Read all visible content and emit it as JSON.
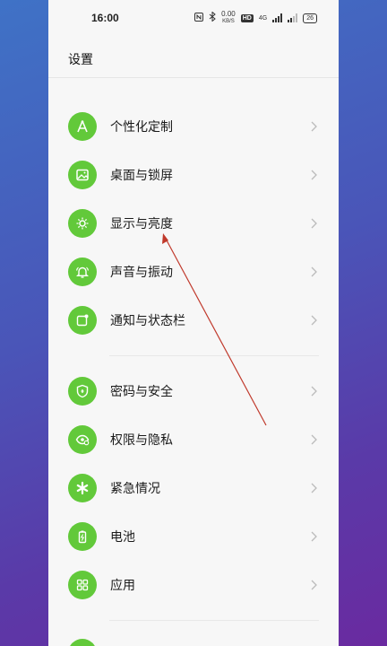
{
  "status": {
    "time": "16:00",
    "speed_value": "0.00",
    "speed_unit": "KB/S",
    "hd_badge": "HD",
    "network": "4G",
    "battery": "26"
  },
  "page": {
    "title": "设置"
  },
  "groups": [
    {
      "items": [
        {
          "label": "个性化定制",
          "icon": "brush-icon"
        },
        {
          "label": "桌面与锁屏",
          "icon": "image-icon"
        },
        {
          "label": "显示与亮度",
          "icon": "sun-icon"
        },
        {
          "label": "声音与振动",
          "icon": "bell-icon"
        },
        {
          "label": "通知与状态栏",
          "icon": "notification-icon"
        }
      ]
    },
    {
      "items": [
        {
          "label": "密码与安全",
          "icon": "shield-icon"
        },
        {
          "label": "权限与隐私",
          "icon": "privacy-eye-icon"
        },
        {
          "label": "紧急情况",
          "icon": "asterisk-icon"
        },
        {
          "label": "电池",
          "icon": "battery-icon"
        },
        {
          "label": "应用",
          "icon": "apps-grid-icon"
        }
      ]
    }
  ],
  "colors": {
    "icon_bg": "#62c93a",
    "annotation_arrow": "#c0392b"
  }
}
